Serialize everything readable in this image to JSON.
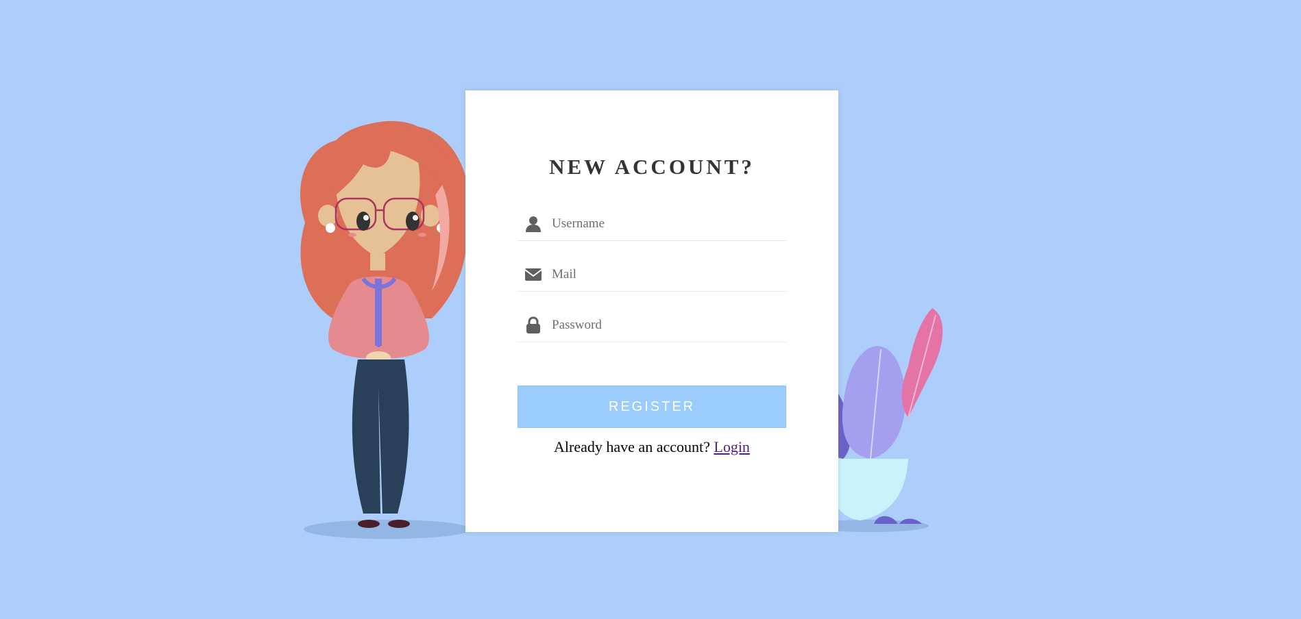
{
  "form": {
    "title": "NEW ACCOUNT?",
    "fields": {
      "username": {
        "placeholder": "Username",
        "value": ""
      },
      "mail": {
        "placeholder": "Mail",
        "value": ""
      },
      "password": {
        "placeholder": "Password",
        "value": ""
      }
    },
    "register_label": "REGISTER",
    "login_prompt": "Already have an account?",
    "login_link": "Login"
  },
  "icons": {
    "username": "user-icon",
    "mail": "envelope-icon",
    "password": "lock-icon"
  },
  "colors": {
    "background": "#adcefb",
    "card": "#ffffff",
    "button": "#9acdfd",
    "button_text": "#ffffff",
    "link": "#551a8b",
    "title": "#333333"
  }
}
